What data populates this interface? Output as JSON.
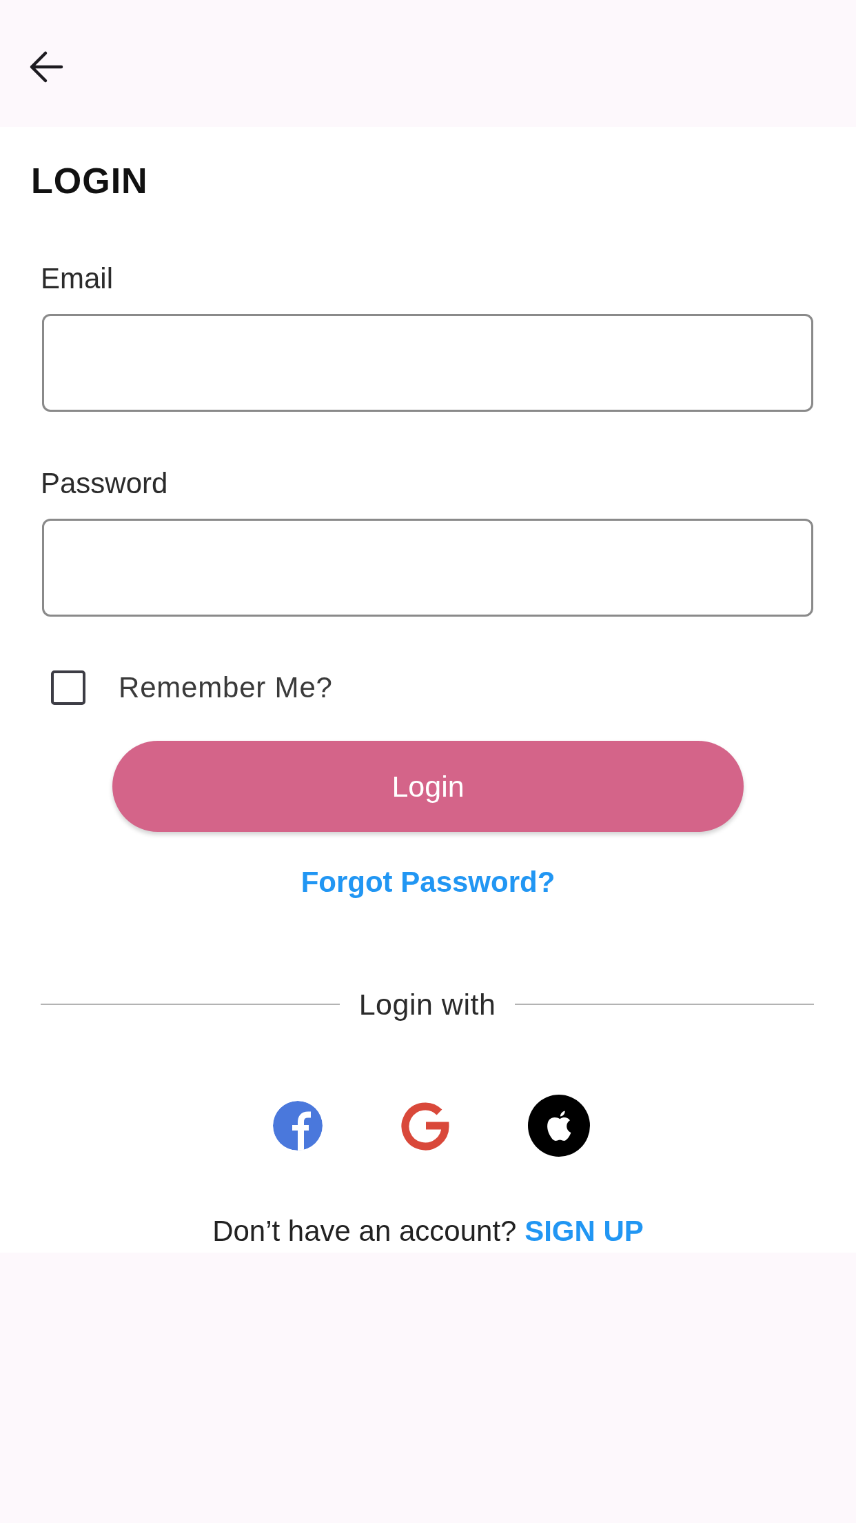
{
  "title": "LOGIN",
  "fields": [
    {
      "label": "Email"
    },
    {
      "label": "Password"
    }
  ],
  "remember": {
    "label": "Remember Me?",
    "checked": false
  },
  "login_button": "Login",
  "forgot_link": "Forgot Password?",
  "divider": {
    "label": "Login with"
  },
  "signup": {
    "prompt": "Don’t have an account?",
    "link": "SIGN UP"
  }
}
